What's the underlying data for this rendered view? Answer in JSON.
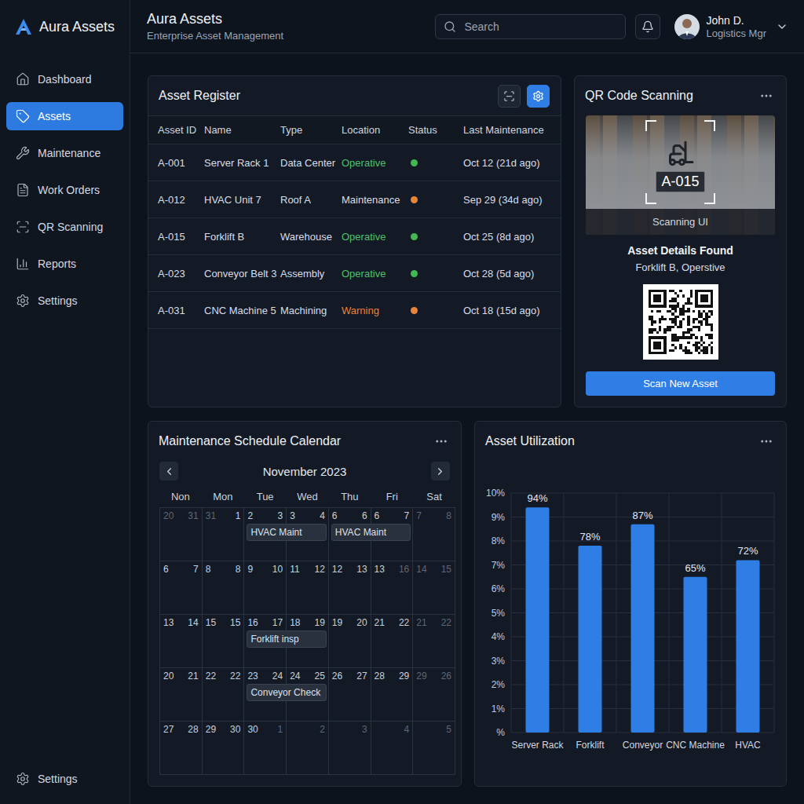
{
  "sidebar": {
    "brand": "Aura Assets",
    "items": [
      {
        "label": "Dashboard",
        "selected": false
      },
      {
        "label": "Assets",
        "selected": true
      },
      {
        "label": "Maintenance",
        "selected": false
      },
      {
        "label": "Work Orders",
        "selected": false
      },
      {
        "label": "QR Scanning",
        "selected": false
      },
      {
        "label": "Reports",
        "selected": false
      },
      {
        "label": "Settings",
        "selected": false
      }
    ],
    "footer": {
      "label": "Settings",
      "selected": false
    }
  },
  "header": {
    "title": "Aura Assets",
    "subtitle": "Enterprise Asset Management",
    "search": {
      "placeholder": "Search"
    },
    "user": {
      "name": "John D.",
      "role": "Logistics Mgr"
    }
  },
  "asset_register": {
    "title": "Asset Register",
    "toolbar_buttons": [
      {
        "selected": false
      },
      {
        "selected": true
      }
    ],
    "columns": [
      "Asset ID",
      "Name",
      "Type",
      "Location",
      "Status",
      "Last Maintenance"
    ],
    "rows": [
      {
        "id": "A-001",
        "name": "Server Rack 1",
        "type": "Data Center",
        "location": "Operative",
        "location_color": "#4cc26a",
        "dot_color": "#3fb950",
        "last_maintenance": "Oct 12 (21d ago)"
      },
      {
        "id": "A-012",
        "name": "HVAC Unit 7",
        "type": "Roof A",
        "location": "Maintenance",
        "location_color": "#d8dee8",
        "dot_color": "#e8833a",
        "last_maintenance": "Sep 29 (34d ago)"
      },
      {
        "id": "A-015",
        "name": "Forklift B",
        "type": "Warehouse",
        "location": "Operative",
        "location_color": "#4cc26a",
        "dot_color": "#3fb950",
        "last_maintenance": "Oct 25 (8d ago)"
      },
      {
        "id": "A-023",
        "name": "Conveyor Belt 3",
        "type": "Assembly",
        "location": "Operative",
        "location_color": "#4cc26a",
        "dot_color": "#3fb950",
        "last_maintenance": "Oct 28 (5d ago)"
      },
      {
        "id": "A-031",
        "name": "CNC Machine 5",
        "type": "Machining",
        "location": "Warning",
        "location_color": "#e8833a",
        "dot_color": "#e8833a",
        "last_maintenance": "Oct 18 (15d ago)"
      }
    ]
  },
  "qr_scanning": {
    "title": "QR Code Scanning",
    "tag": "A-015",
    "caption": "Scanning UI",
    "result_title": "Asset Details Found",
    "result_text": "Forklift B, Operstive",
    "button": "Scan New Asset"
  },
  "calendar": {
    "title": "Maintenance Schedule Calendar",
    "month": "November 2023",
    "weekdays": [
      "Non",
      "Mon",
      "Tue",
      "Wed",
      "Thu",
      "Fri",
      "Sat"
    ],
    "weeks": [
      {
        "days": [
          [
            {
              "text": "20",
              "muted": true
            },
            {
              "text": "31",
              "muted": true
            }
          ],
          [
            {
              "text": "31",
              "muted": true
            },
            {
              "text": "1",
              "muted": false
            }
          ],
          [
            {
              "text": "2",
              "muted": false
            },
            {
              "text": "3",
              "muted": false
            }
          ],
          [
            {
              "text": "3",
              "muted": false
            },
            {
              "text": "4",
              "muted": false
            }
          ],
          [
            {
              "text": "6",
              "muted": false
            },
            {
              "text": "6",
              "muted": false
            }
          ],
          [
            {
              "text": "6",
              "muted": false
            },
            {
              "text": "7",
              "muted": false
            }
          ],
          [
            {
              "text": "7",
              "muted": true
            },
            {
              "text": "8",
              "muted": true
            }
          ]
        ],
        "events": [
          {
            "label": "HVAC Maint",
            "start": 2,
            "span": 2
          },
          {
            "label": "HVAC Maint",
            "start": 4,
            "span": 2
          }
        ]
      },
      {
        "days": [
          [
            {
              "text": "6",
              "muted": false
            },
            {
              "text": "7",
              "muted": false
            }
          ],
          [
            {
              "text": "8",
              "muted": false
            },
            {
              "text": "8",
              "muted": false
            }
          ],
          [
            {
              "text": "9",
              "muted": false
            },
            {
              "text": "10",
              "muted": false
            }
          ],
          [
            {
              "text": "11",
              "muted": false
            },
            {
              "text": "12",
              "muted": false
            }
          ],
          [
            {
              "text": "12",
              "muted": false
            },
            {
              "text": "13",
              "muted": false
            }
          ],
          [
            {
              "text": "13",
              "muted": false
            },
            {
              "text": "16",
              "muted": true
            }
          ],
          [
            {
              "text": "14",
              "muted": true
            },
            {
              "text": "15",
              "muted": true
            }
          ]
        ],
        "events": []
      },
      {
        "days": [
          [
            {
              "text": "13",
              "muted": false
            },
            {
              "text": "14",
              "muted": false
            }
          ],
          [
            {
              "text": "15",
              "muted": false
            },
            {
              "text": "15",
              "muted": false
            }
          ],
          [
            {
              "text": "16",
              "muted": false
            },
            {
              "text": "17",
              "muted": false
            }
          ],
          [
            {
              "text": "18",
              "muted": false
            },
            {
              "text": "19",
              "muted": false
            }
          ],
          [
            {
              "text": "19",
              "muted": false
            },
            {
              "text": "20",
              "muted": false
            }
          ],
          [
            {
              "text": "21",
              "muted": false
            },
            {
              "text": "22",
              "muted": false
            }
          ],
          [
            {
              "text": "21",
              "muted": true
            },
            {
              "text": "22",
              "muted": true
            }
          ]
        ],
        "events": [
          {
            "label": "Forklift insp",
            "start": 2,
            "span": 2
          }
        ]
      },
      {
        "days": [
          [
            {
              "text": "20",
              "muted": false
            },
            {
              "text": "21",
              "muted": false
            }
          ],
          [
            {
              "text": "22",
              "muted": false
            },
            {
              "text": "22",
              "muted": false
            }
          ],
          [
            {
              "text": "23",
              "muted": false
            },
            {
              "text": "24",
              "muted": false
            }
          ],
          [
            {
              "text": "24",
              "muted": false
            },
            {
              "text": "25",
              "muted": false
            }
          ],
          [
            {
              "text": "26",
              "muted": false
            },
            {
              "text": "27",
              "muted": false
            }
          ],
          [
            {
              "text": "28",
              "muted": false
            },
            {
              "text": "29",
              "muted": false
            }
          ],
          [
            {
              "text": "29",
              "muted": true
            },
            {
              "text": "26",
              "muted": true
            }
          ]
        ],
        "events": [
          {
            "label": "Conveyor Check",
            "start": 2,
            "span": 2
          }
        ]
      },
      {
        "days": [
          [
            {
              "text": "27",
              "muted": false
            },
            {
              "text": "28",
              "muted": false
            }
          ],
          [
            {
              "text": "29",
              "muted": false
            },
            {
              "text": "30",
              "muted": false
            }
          ],
          [
            {
              "text": "30",
              "muted": false
            },
            {
              "text": "1",
              "muted": true
            }
          ],
          [
            {
              "text": "2",
              "muted": true
            }
          ],
          [
            {
              "text": "3",
              "muted": true
            }
          ],
          [
            {
              "text": "4",
              "muted": true
            }
          ],
          [
            {
              "text": "5",
              "muted": true
            }
          ]
        ],
        "events": []
      }
    ]
  },
  "utilization": {
    "title": "Asset Utilization",
    "y_ticks": [
      "10%",
      "9%",
      "8%",
      "7%",
      "6%",
      "5%",
      "4%",
      "3%",
      "2%",
      "1%",
      "%"
    ],
    "max": 10,
    "categories": [
      "Server Rack",
      "Forklift",
      "Conveyor",
      "CNC Machine",
      "HVAC"
    ],
    "series": [
      {
        "values": [
          9.4,
          7.8,
          8.7,
          6.5,
          7.2
        ]
      }
    ],
    "value_labels": [
      "94%",
      "78%",
      "87%",
      "65%",
      "72%"
    ]
  }
}
